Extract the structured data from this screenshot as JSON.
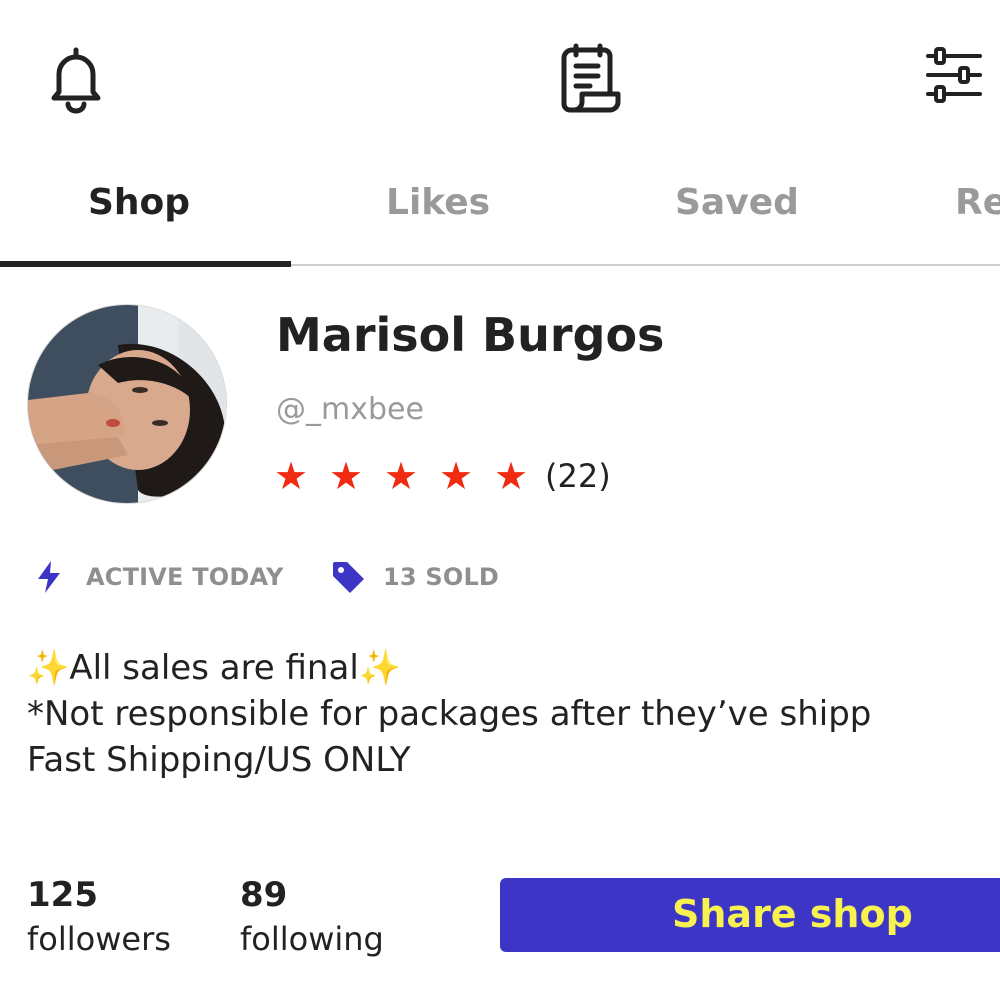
{
  "header": {
    "icons": [
      "bell-icon",
      "receipt-icon",
      "sliders-icon"
    ]
  },
  "tabs": [
    {
      "label": "Shop",
      "active": true
    },
    {
      "label": "Likes",
      "active": false
    },
    {
      "label": "Saved",
      "active": false
    },
    {
      "label": "Re",
      "active": false
    }
  ],
  "profile": {
    "name": "Marisol Burgos",
    "handle": "@_mxbee",
    "rating": 5,
    "review_count": "(22)",
    "star_color": "#f02b12"
  },
  "meta": {
    "active_label": "ACTIVE TODAY",
    "sold_label": "13 SOLD",
    "accent_color": "#3c35c6"
  },
  "bio": {
    "line1": "✨All sales are final✨",
    "line2": "*Not responsible for packages after they’ve shipp",
    "line3": "Fast Shipping/US ONLY"
  },
  "stats": {
    "followers_count": "125",
    "followers_label": "followers",
    "following_count": "89",
    "following_label": "following"
  },
  "share": {
    "label": "Share shop",
    "bg_color": "#3c35c6",
    "text_color": "#f7f250"
  }
}
